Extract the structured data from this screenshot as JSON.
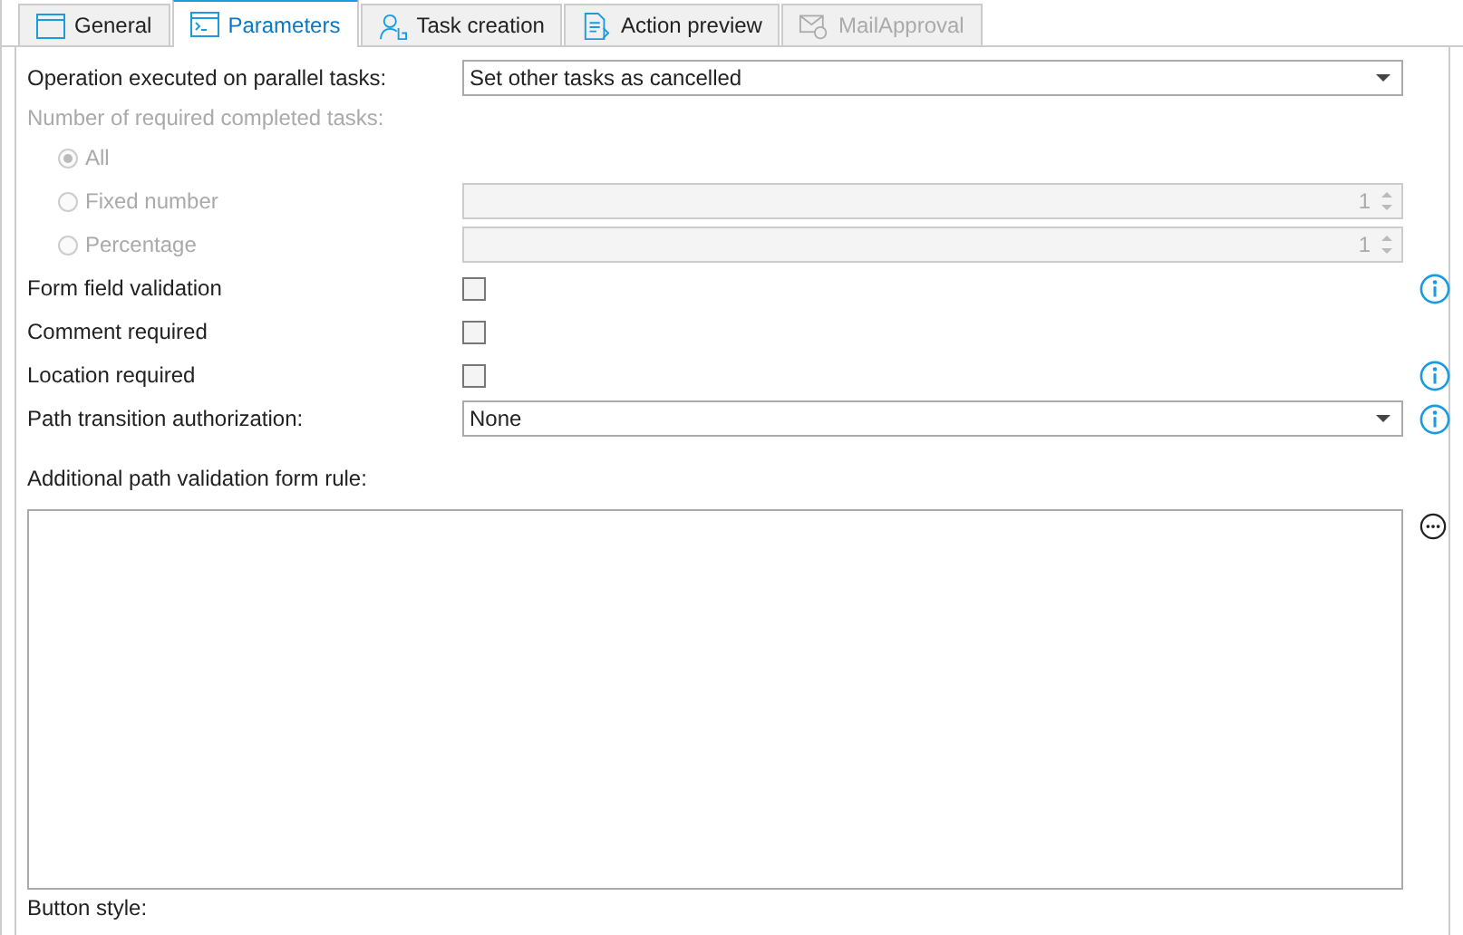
{
  "tabs": [
    {
      "label": "General",
      "selected": false,
      "disabled": false
    },
    {
      "label": "Parameters",
      "selected": true,
      "disabled": false
    },
    {
      "label": "Task creation",
      "selected": false,
      "disabled": false
    },
    {
      "label": "Action preview",
      "selected": false,
      "disabled": false
    },
    {
      "label": "MailApproval",
      "selected": false,
      "disabled": true
    }
  ],
  "rows": [
    {
      "kind": "dropdown",
      "label": "Operation executed on parallel tasks:",
      "value": "Set other tasks as cancelled",
      "info": false
    },
    {
      "kind": "heading",
      "label": "Number of required completed tasks:",
      "disabled": true
    },
    {
      "kind": "radio",
      "label": "All",
      "selected": true,
      "disabled": true
    },
    {
      "kind": "radio",
      "label": "Fixed number",
      "selected": false,
      "disabled": true,
      "spinner_value": "1"
    },
    {
      "kind": "radio",
      "label": "Percentage",
      "selected": false,
      "disabled": true,
      "spinner_value": "1"
    },
    {
      "kind": "checkbox",
      "label": "Form field validation",
      "checked": false,
      "info": true
    },
    {
      "kind": "checkbox",
      "label": "Comment required",
      "checked": false,
      "info": false
    },
    {
      "kind": "checkbox",
      "label": "Location required",
      "checked": false,
      "info": true
    },
    {
      "kind": "dropdown",
      "label": "Path transition authorization:",
      "value": "None",
      "info": true
    }
  ],
  "rule_editor": {
    "label": "Additional path validation form rule:"
  },
  "next_section_label": "Button style:"
}
